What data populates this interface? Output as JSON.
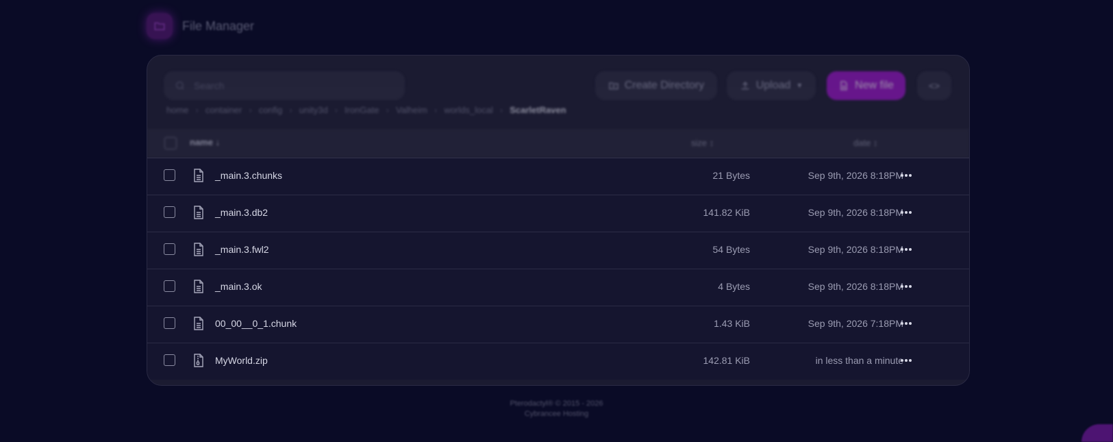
{
  "app": {
    "title": "File Manager"
  },
  "toolbar": {
    "search_placeholder": "Search",
    "create_directory_label": "Create Directory",
    "upload_label": "Upload",
    "new_file_label": "New file",
    "code_label": "<>"
  },
  "breadcrumb": [
    "home",
    "container",
    "config",
    "unity3d",
    "IronGate",
    "Valheim",
    "worlds_local",
    "ScarletRaven"
  ],
  "table": {
    "headers": {
      "name": "name ↓",
      "size": "size ↕",
      "date": "date ↕"
    },
    "rows": [
      {
        "name": "_main.3.chunks",
        "size": "21 Bytes",
        "date": "Sep 9th, 2026 8:18PM",
        "icon": "file-text-icon"
      },
      {
        "name": "_main.3.db2",
        "size": "141.82 KiB",
        "date": "Sep 9th, 2026 8:18PM",
        "icon": "file-text-icon"
      },
      {
        "name": "_main.3.fwl2",
        "size": "54 Bytes",
        "date": "Sep 9th, 2026 8:18PM",
        "icon": "file-text-icon"
      },
      {
        "name": "_main.3.ok",
        "size": "4 Bytes",
        "date": "Sep 9th, 2026 8:18PM",
        "icon": "file-text-icon"
      },
      {
        "name": "00_00__0_1.chunk",
        "size": "1.43 KiB",
        "date": "Sep 9th, 2026 7:18PM",
        "icon": "file-text-icon"
      },
      {
        "name": "MyWorld.zip",
        "size": "142.81 KiB",
        "date": "in less than a minute",
        "icon": "file-archive-icon"
      }
    ]
  },
  "footer": {
    "line1": "Pterodactyl® © 2015 - 2026",
    "line2": "Cybrancee Hosting"
  },
  "colors": {
    "background": "#0a0b26",
    "card": "#1b1b31",
    "accent": "#9a14c8"
  }
}
